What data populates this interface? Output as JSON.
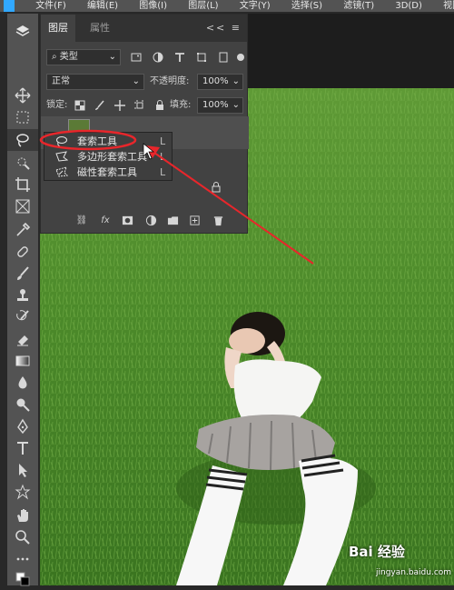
{
  "menubar": {
    "items": [
      "文件(F)",
      "编辑(E)",
      "图像(I)",
      "图层(L)",
      "文字(Y)",
      "选择(S)",
      "滤镜(T)",
      "3D(D)",
      "视图(V)"
    ]
  },
  "panel": {
    "tab_layers": "图层",
    "tab_properties": "属性",
    "collapse": "<<",
    "filter_kind": "类型",
    "blend_mode": "正常",
    "opacity_label": "不透明度:",
    "opacity_value": "100%",
    "lock_label": "锁定:",
    "fill_label": "填充:",
    "fill_value": "100%",
    "fx_label": "fx"
  },
  "flyout": {
    "items": [
      {
        "label": "套索工具",
        "shortcut": "L",
        "icon": "lasso-icon"
      },
      {
        "label": "多边形套索工具",
        "shortcut": "L",
        "icon": "polygonal-lasso-icon"
      },
      {
        "label": "磁性套索工具",
        "shortcut": "L",
        "icon": "magnetic-lasso-icon"
      }
    ]
  },
  "watermark": {
    "brand": "Bai 经验",
    "url": "jingyan.baidu.com"
  },
  "colors": {
    "annotation": "#e8262b",
    "accent": "#31a8ff"
  }
}
